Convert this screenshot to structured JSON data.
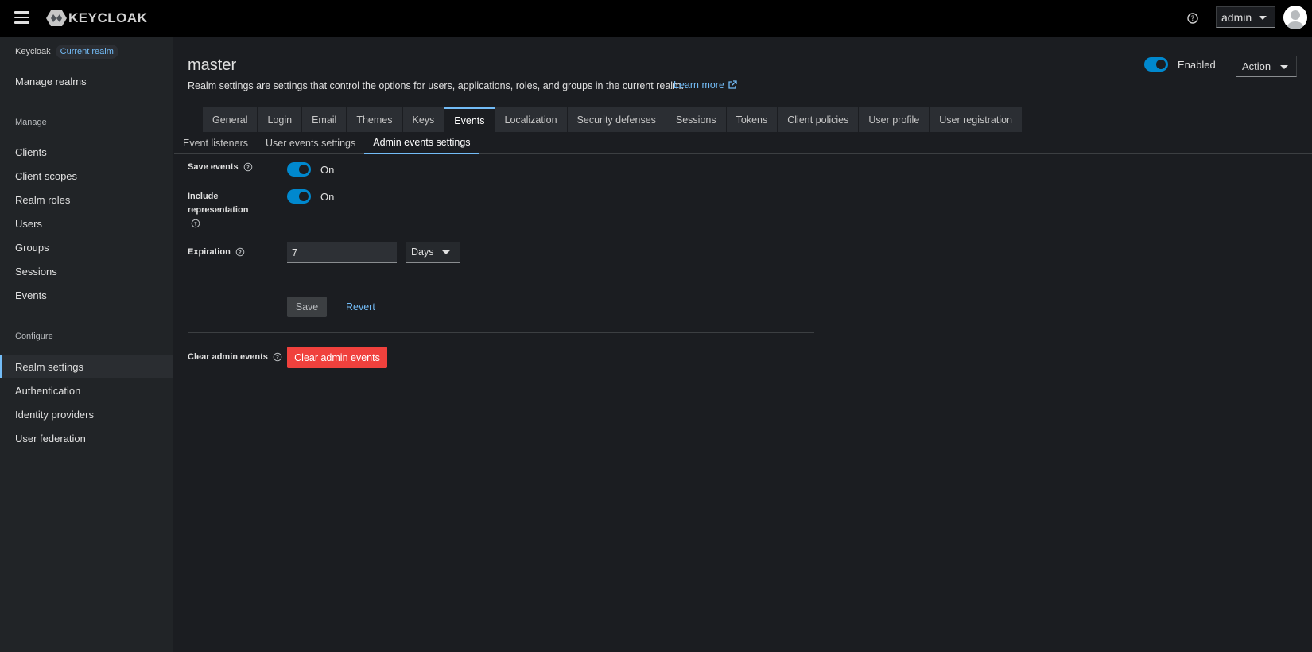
{
  "header": {
    "logo_text": "KEYCLOAK",
    "user": "admin"
  },
  "sidebar": {
    "realm_name": "Keycloak",
    "realm_badge": "Current realm",
    "manage_realms": "Manage realms",
    "manage_section": "Manage",
    "manage_items": [
      "Clients",
      "Client scopes",
      "Realm roles",
      "Users",
      "Groups",
      "Sessions",
      "Events"
    ],
    "configure_section": "Configure",
    "configure_items": [
      "Realm settings",
      "Authentication",
      "Identity providers",
      "User federation"
    ],
    "active_item": "Realm settings"
  },
  "page": {
    "title": "master",
    "description": "Realm settings are settings that control the options for users, applications, roles, and groups in the current realm.",
    "learn_more": "Learn more",
    "enabled_label": "Enabled",
    "enabled": true,
    "action_label": "Action"
  },
  "tabs": [
    "General",
    "Login",
    "Email",
    "Themes",
    "Keys",
    "Events",
    "Localization",
    "Security defenses",
    "Sessions",
    "Tokens",
    "Client policies",
    "User profile",
    "User registration"
  ],
  "active_tab": "Events",
  "subtabs": [
    "Event listeners",
    "User events settings",
    "Admin events settings"
  ],
  "active_subtab": "Admin events settings",
  "form": {
    "save_events_label": "Save events",
    "save_events_state": "On",
    "include_repr_label": "Include representation",
    "include_repr_state": "On",
    "expiration_label": "Expiration",
    "expiration_value": "7",
    "expiration_unit": "Days",
    "save_label": "Save",
    "revert_label": "Revert",
    "clear_label": "Clear admin events",
    "clear_button": "Clear admin events"
  },
  "colors": {
    "accent": "#73bcf7",
    "toggle_on": "#0088ce",
    "danger": "#f0413d"
  }
}
